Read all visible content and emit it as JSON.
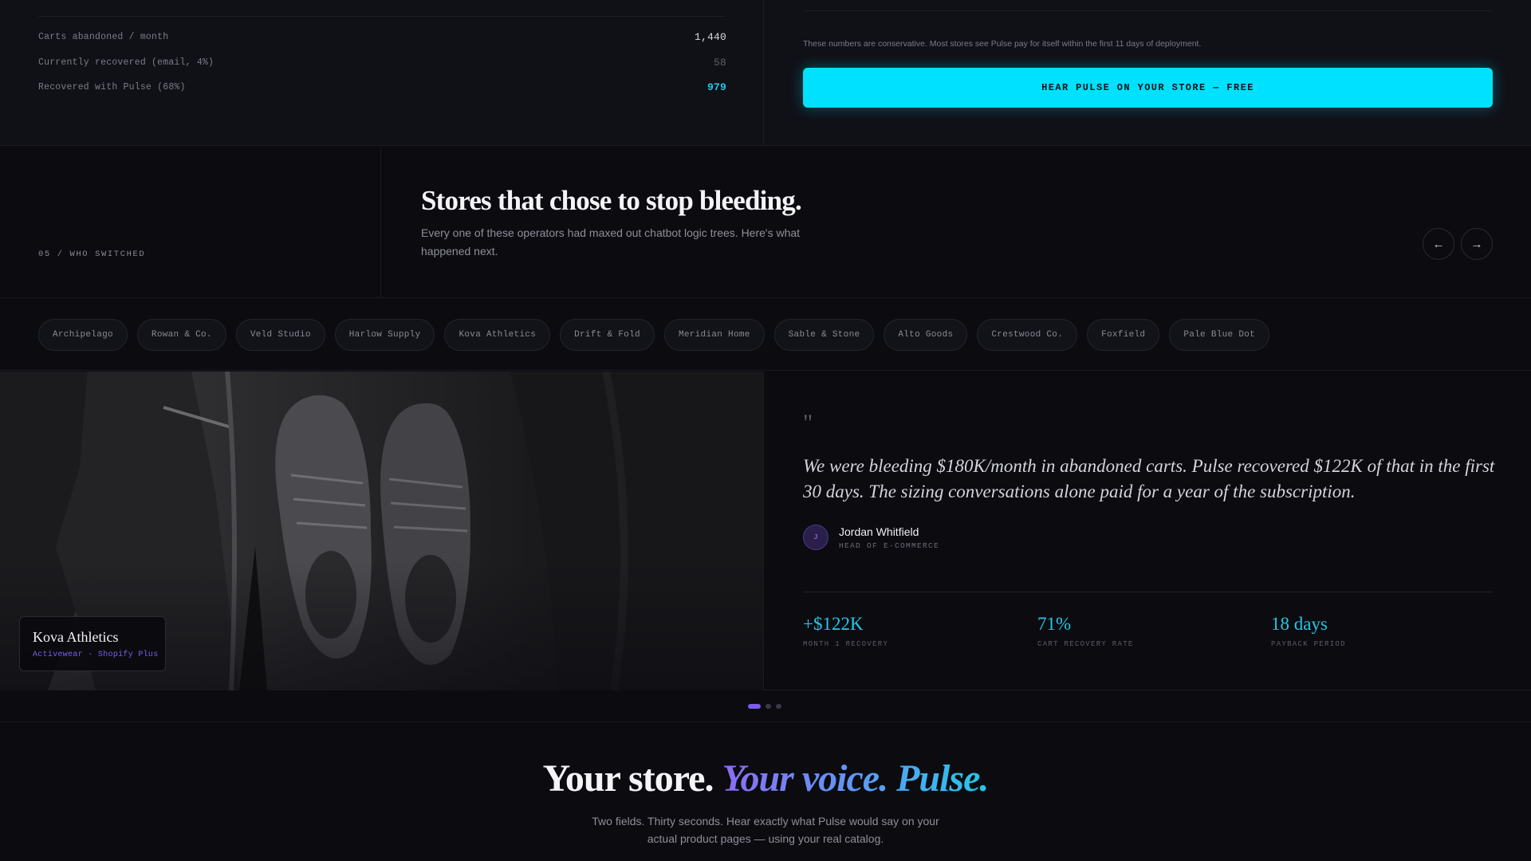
{
  "calculator": {
    "rows": [
      {
        "label": "Carts abandoned / month",
        "value": "1,440"
      },
      {
        "label": "Currently recovered (email, 4%)",
        "value": "58"
      },
      {
        "label": "Recovered with Pulse (68%)",
        "value": "979"
      }
    ],
    "disclaimer": "These numbers are conservative. Most stores see Pulse pay for itself within the first 11 days of deployment.",
    "cta_label": "HEAR PULSE ON YOUR STORE — FREE"
  },
  "who_switched": {
    "section_tag": "05 / WHO SWITCHED",
    "title": "Stores that chose to stop bleeding.",
    "subtitle": "Every one of these operators had maxed out chatbot logic trees. Here's what happened next.",
    "prev_icon": "←",
    "next_icon": "→"
  },
  "stores": [
    "Archipelago",
    "Rowan & Co.",
    "Veld Studio",
    "Harlow Supply",
    "Kova Athletics",
    "Drift & Fold",
    "Meridian Home",
    "Sable & Stone",
    "Alto Goods",
    "Crestwood Co.",
    "Foxfield",
    "Pale Blue Dot"
  ],
  "testimonial": {
    "store_name": "Kova Athletics",
    "store_meta": "Activewear · Shopify Plus",
    "quote_mark": "\"",
    "quote": "We were bleeding $180K/month in abandoned carts. Pulse recovered $122K of that in the first 30 days. The sizing conversations alone paid for a year of the subscription.",
    "avatar_initial": "J",
    "person_name": "Jordan Whitfield",
    "person_role": "HEAD OF E-COMMERCE",
    "stats": [
      {
        "value": "+$122K",
        "caption": "MONTH 1 RECOVERY"
      },
      {
        "value": "71%",
        "caption": "CART RECOVERY RATE"
      },
      {
        "value": "18 days",
        "caption": "PAYBACK PERIOD"
      }
    ]
  },
  "pagination": {
    "total": 3,
    "active": 1
  },
  "closing": {
    "title_plain": "Your store.",
    "title_accent": "Your voice. Pulse.",
    "subtitle": "Two fields. Thirty seconds. Hear exactly what Pulse would say on your actual product pages — using your real catalog."
  },
  "colors": {
    "accent_cyan": "#00e1ff",
    "accent_purple": "#7a5cf0",
    "background": "#0b0b10"
  }
}
